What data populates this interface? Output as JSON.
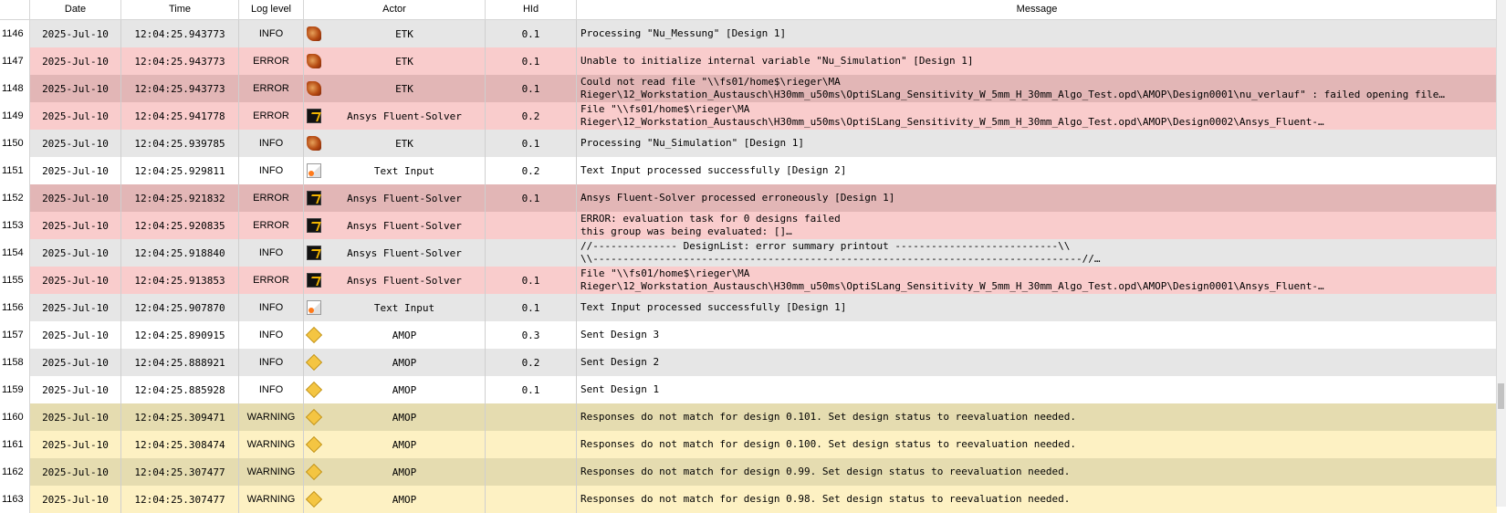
{
  "columns": {
    "date": "Date",
    "time": "Time",
    "level": "Log level",
    "actor": "Actor",
    "hid": "HId",
    "message": "Message"
  },
  "rows": [
    {
      "idx": "1146",
      "date": "2025-Jul-10",
      "time": "12:04:25.943773",
      "level": "INFO",
      "icon": "etk-icon",
      "actor": "ETK",
      "hid": "0.1",
      "msg1": "Processing \"Nu_Messung\" [Design 1]",
      "msg2": "",
      "style": "r-info-grey"
    },
    {
      "idx": "1147",
      "date": "2025-Jul-10",
      "time": "12:04:25.943773",
      "level": "ERROR",
      "icon": "etk-icon",
      "actor": "ETK",
      "hid": "0.1",
      "msg1": "Unable to initialize internal variable \"Nu_Simulation\" [Design 1]",
      "msg2": "",
      "style": "r-err-light"
    },
    {
      "idx": "1148",
      "date": "2025-Jul-10",
      "time": "12:04:25.943773",
      "level": "ERROR",
      "icon": "etk-icon",
      "actor": "ETK",
      "hid": "0.1",
      "msg1": "Could not read file \"\\\\fs01/home$\\rieger\\MA",
      "msg2": "Rieger\\12_Workstation_Austausch\\H30mm_u50ms\\OptiSLang_Sensitivity_W_5mm_H_30mm_Algo_Test.opd\\AMOP\\Design0001\\nu_verlauf\" : failed opening file…",
      "style": "r-err-dark"
    },
    {
      "idx": "1149",
      "date": "2025-Jul-10",
      "time": "12:04:25.941778",
      "level": "ERROR",
      "icon": "ansys-fluent-icon",
      "actor": "Ansys Fluent-Solver",
      "hid": "0.2",
      "msg1": "File \"\\\\fs01/home$\\rieger\\MA",
      "msg2": "Rieger\\12_Workstation_Austausch\\H30mm_u50ms\\OptiSLang_Sensitivity_W_5mm_H_30mm_Algo_Test.opd\\AMOP\\Design0002\\Ansys_Fluent-…",
      "style": "r-err-light"
    },
    {
      "idx": "1150",
      "date": "2025-Jul-10",
      "time": "12:04:25.939785",
      "level": "INFO",
      "icon": "etk-icon",
      "actor": "ETK",
      "hid": "0.1",
      "msg1": "Processing \"Nu_Simulation\" [Design 1]",
      "msg2": "",
      "style": "r-info-grey"
    },
    {
      "idx": "1151",
      "date": "2025-Jul-10",
      "time": "12:04:25.929811",
      "level": "INFO",
      "icon": "text-input-icon",
      "actor": "Text Input",
      "hid": "0.2",
      "msg1": "Text Input processed successfully [Design 2]",
      "msg2": "",
      "style": "r-info-white"
    },
    {
      "idx": "1152",
      "date": "2025-Jul-10",
      "time": "12:04:25.921832",
      "level": "ERROR",
      "icon": "ansys-fluent-icon",
      "actor": "Ansys Fluent-Solver",
      "hid": "0.1",
      "msg1": "Ansys Fluent-Solver processed erroneously [Design 1]",
      "msg2": "",
      "style": "r-err-dark"
    },
    {
      "idx": "1153",
      "date": "2025-Jul-10",
      "time": "12:04:25.920835",
      "level": "ERROR",
      "icon": "ansys-fluent-icon",
      "actor": "Ansys Fluent-Solver",
      "hid": "",
      "msg1": "ERROR: evaluation task for 0 designs failed",
      "msg2": "this group was being evaluated: []…",
      "style": "r-err-light"
    },
    {
      "idx": "1154",
      "date": "2025-Jul-10",
      "time": "12:04:25.918840",
      "level": "INFO",
      "icon": "ansys-fluent-icon",
      "actor": "Ansys Fluent-Solver",
      "hid": "",
      "msg1": "//-------------- DesignList: error summary printout ---------------------------\\\\",
      "msg2": "\\\\---------------------------------------------------------------------------------//…",
      "style": "r-info-grey"
    },
    {
      "idx": "1155",
      "date": "2025-Jul-10",
      "time": "12:04:25.913853",
      "level": "ERROR",
      "icon": "ansys-fluent-icon",
      "actor": "Ansys Fluent-Solver",
      "hid": "0.1",
      "msg1": "File \"\\\\fs01/home$\\rieger\\MA",
      "msg2": "Rieger\\12_Workstation_Austausch\\H30mm_u50ms\\OptiSLang_Sensitivity_W_5mm_H_30mm_Algo_Test.opd\\AMOP\\Design0001\\Ansys_Fluent-…",
      "style": "r-err-light"
    },
    {
      "idx": "1156",
      "date": "2025-Jul-10",
      "time": "12:04:25.907870",
      "level": "INFO",
      "icon": "text-input-icon",
      "actor": "Text Input",
      "hid": "0.1",
      "msg1": "Text Input processed successfully [Design 1]",
      "msg2": "",
      "style": "r-info-grey"
    },
    {
      "idx": "1157",
      "date": "2025-Jul-10",
      "time": "12:04:25.890915",
      "level": "INFO",
      "icon": "amop-icon",
      "actor": "AMOP",
      "hid": "0.3",
      "msg1": "Sent Design 3",
      "msg2": "",
      "style": "r-info-white"
    },
    {
      "idx": "1158",
      "date": "2025-Jul-10",
      "time": "12:04:25.888921",
      "level": "INFO",
      "icon": "amop-icon",
      "actor": "AMOP",
      "hid": "0.2",
      "msg1": "Sent Design 2",
      "msg2": "",
      "style": "r-info-grey"
    },
    {
      "idx": "1159",
      "date": "2025-Jul-10",
      "time": "12:04:25.885928",
      "level": "INFO",
      "icon": "amop-icon",
      "actor": "AMOP",
      "hid": "0.1",
      "msg1": "Sent Design 1",
      "msg2": "",
      "style": "r-info-white"
    },
    {
      "idx": "1160",
      "date": "2025-Jul-10",
      "time": "12:04:25.309471",
      "level": "WARNING",
      "icon": "amop-icon",
      "actor": "AMOP",
      "hid": "",
      "msg1": "Responses do not match for design 0.101. Set design status to reevaluation needed.",
      "msg2": "",
      "style": "r-warn-dark"
    },
    {
      "idx": "1161",
      "date": "2025-Jul-10",
      "time": "12:04:25.308474",
      "level": "WARNING",
      "icon": "amop-icon",
      "actor": "AMOP",
      "hid": "",
      "msg1": "Responses do not match for design 0.100. Set design status to reevaluation needed.",
      "msg2": "",
      "style": "r-warn-light"
    },
    {
      "idx": "1162",
      "date": "2025-Jul-10",
      "time": "12:04:25.307477",
      "level": "WARNING",
      "icon": "amop-icon",
      "actor": "AMOP",
      "hid": "",
      "msg1": "Responses do not match for design 0.99. Set design status to reevaluation needed.",
      "msg2": "",
      "style": "r-warn-dark"
    },
    {
      "idx": "1163",
      "date": "2025-Jul-10",
      "time": "12:04:25.307477",
      "level": "WARNING",
      "icon": "amop-icon",
      "actor": "AMOP",
      "hid": "",
      "msg1": "Responses do not match for design 0.98. Set design status to reevaluation needed.",
      "msg2": "",
      "style": "r-warn-light"
    }
  ]
}
